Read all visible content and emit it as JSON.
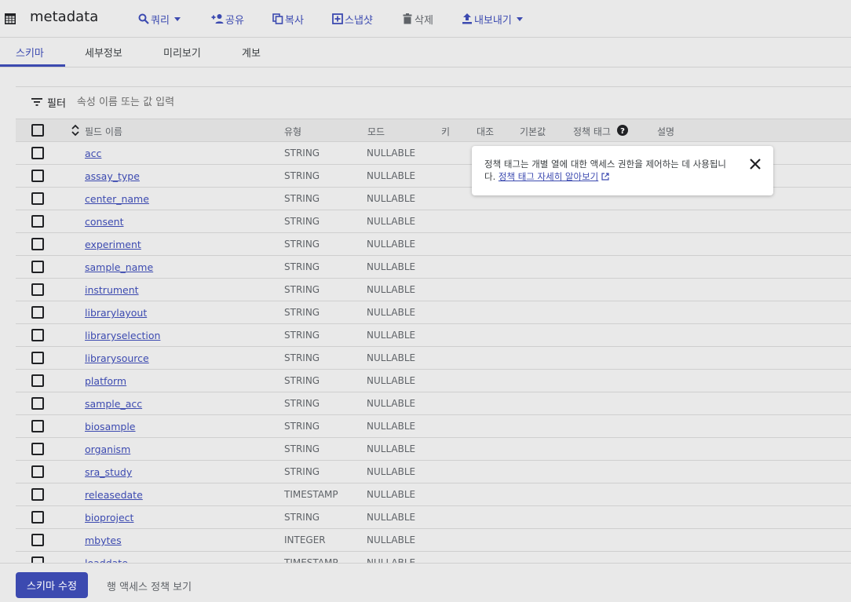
{
  "title": "metadata",
  "toolbar": {
    "query": "쿼리",
    "share": "공유",
    "copy": "복사",
    "snapshot": "스냅샷",
    "delete": "삭제",
    "export": "내보내기"
  },
  "tabs": [
    "스키마",
    "세부정보",
    "미리보기",
    "계보"
  ],
  "filter": {
    "label": "필터",
    "placeholder": "속성 이름 또는 값 입력"
  },
  "columns": {
    "field_name": "필드 이름",
    "type": "유형",
    "mode": "모드",
    "key": "키",
    "collation": "대조",
    "default": "기본값",
    "policy_tags": "정책 태그",
    "description": "설명"
  },
  "rows": [
    {
      "name": "acc",
      "type": "STRING",
      "mode": "NULLABLE"
    },
    {
      "name": "assay_type",
      "type": "STRING",
      "mode": "NULLABLE"
    },
    {
      "name": "center_name",
      "type": "STRING",
      "mode": "NULLABLE"
    },
    {
      "name": "consent",
      "type": "STRING",
      "mode": "NULLABLE"
    },
    {
      "name": "experiment",
      "type": "STRING",
      "mode": "NULLABLE"
    },
    {
      "name": "sample_name",
      "type": "STRING",
      "mode": "NULLABLE"
    },
    {
      "name": "instrument",
      "type": "STRING",
      "mode": "NULLABLE"
    },
    {
      "name": "librarylayout",
      "type": "STRING",
      "mode": "NULLABLE"
    },
    {
      "name": "libraryselection",
      "type": "STRING",
      "mode": "NULLABLE"
    },
    {
      "name": "librarysource",
      "type": "STRING",
      "mode": "NULLABLE"
    },
    {
      "name": "platform",
      "type": "STRING",
      "mode": "NULLABLE"
    },
    {
      "name": "sample_acc",
      "type": "STRING",
      "mode": "NULLABLE"
    },
    {
      "name": "biosample",
      "type": "STRING",
      "mode": "NULLABLE"
    },
    {
      "name": "organism",
      "type": "STRING",
      "mode": "NULLABLE"
    },
    {
      "name": "sra_study",
      "type": "STRING",
      "mode": "NULLABLE"
    },
    {
      "name": "releasedate",
      "type": "TIMESTAMP",
      "mode": "NULLABLE"
    },
    {
      "name": "bioproject",
      "type": "STRING",
      "mode": "NULLABLE"
    },
    {
      "name": "mbytes",
      "type": "INTEGER",
      "mode": "NULLABLE"
    },
    {
      "name": "loaddate",
      "type": "TIMESTAMP",
      "mode": "NULLABLE"
    }
  ],
  "popup": {
    "text": "정책 태그는 개별 열에 대한 액세스 권한을 제어하는 데 사용됩니다.",
    "link": "정책 태그 자세히 알아보기"
  },
  "footer": {
    "edit_schema": "스키마 수정",
    "view_row_policies": "행 액세스 정책 보기"
  },
  "colors": {
    "accent": "#3c4ab0",
    "background": "#e9e9e9"
  }
}
